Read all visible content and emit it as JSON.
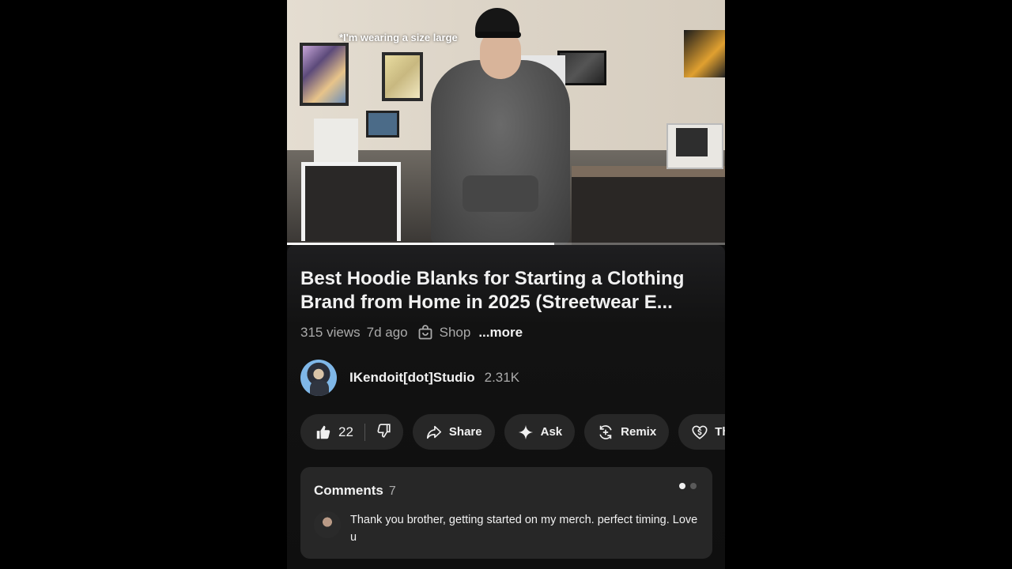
{
  "video": {
    "overlay_caption": "*I'm wearing a size large",
    "progress": 0.61
  },
  "info": {
    "title": "Best Hoodie Blanks for Starting a Clothing Brand from Home in 2025 (Streetwear E...",
    "views": "315 views",
    "age": "7d ago",
    "shop_label": "Shop",
    "more_label": "...more"
  },
  "channel": {
    "name": "IKendoit[dot]Studio",
    "subscribers": "2.31K"
  },
  "actions": {
    "like_count": "22",
    "share_label": "Share",
    "ask_label": "Ask",
    "remix_label": "Remix",
    "thanks_label": "Thanks"
  },
  "comments": {
    "label": "Comments",
    "count": "7",
    "first_comment": "Thank you brother,  getting started on my merch. perfect timing. Love u"
  },
  "colors": {
    "background": "#0f0f0f",
    "pill": "#272727",
    "text_primary": "#f1f1f1",
    "text_secondary": "#aaaaaa"
  },
  "icons": [
    "thumbs-up-icon",
    "thumbs-down-icon",
    "share-arrow-icon",
    "sparkle-icon",
    "remix-icon",
    "heart-dollar-icon",
    "shopping-bag-icon"
  ]
}
